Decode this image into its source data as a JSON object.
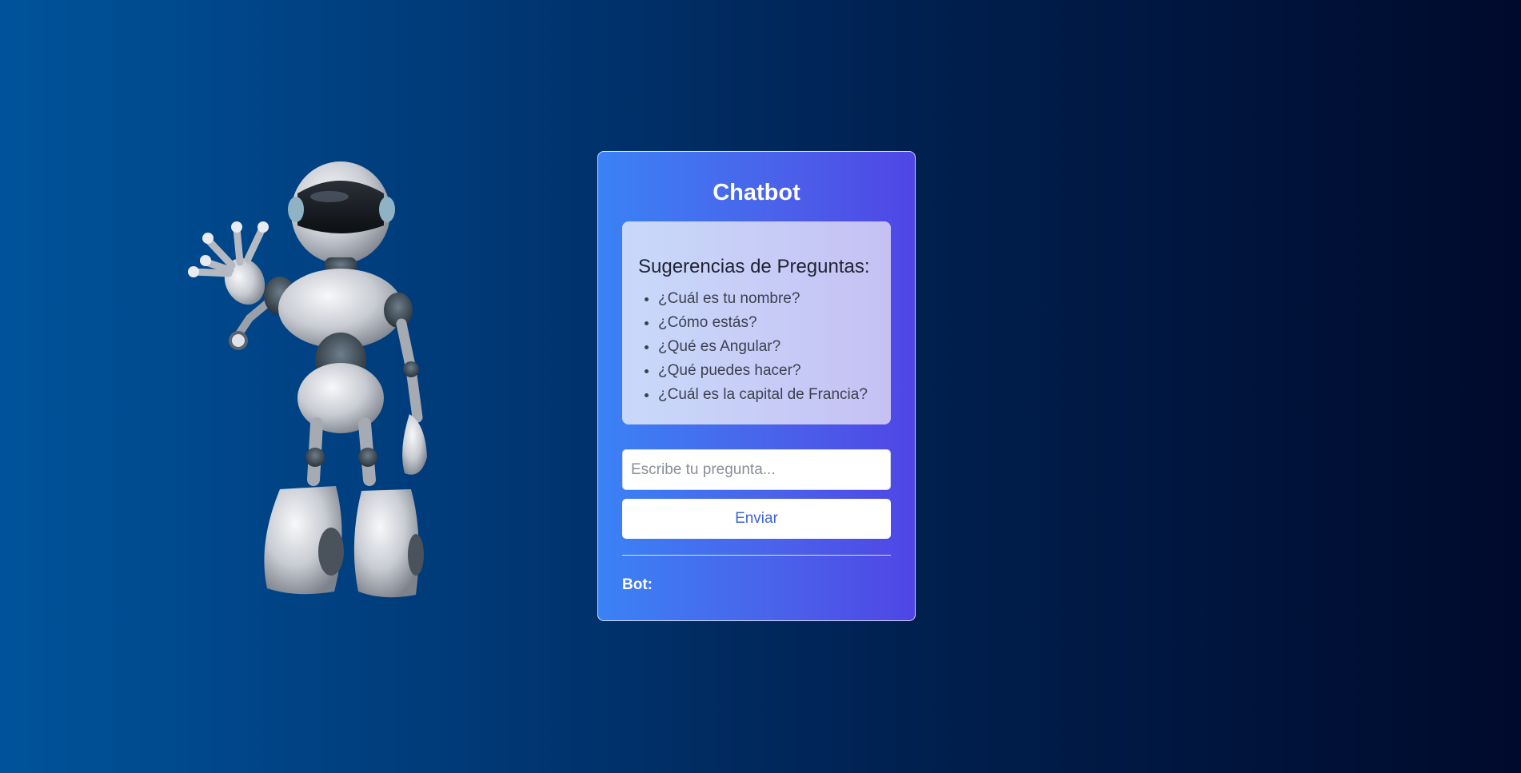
{
  "chatbot": {
    "title": "Chatbot",
    "suggestions": {
      "title": "Sugerencias de Preguntas:",
      "items": [
        "¿Cuál es tu nombre?",
        "¿Cómo estás?",
        "¿Qué es Angular?",
        "¿Qué puedes hacer?",
        "¿Cuál es la capital de Francia?"
      ]
    },
    "input": {
      "placeholder": "Escribe tu pregunta...",
      "value": ""
    },
    "send_label": "Enviar",
    "bot_label": "Bot:",
    "bot_response": ""
  },
  "robot_image": {
    "icon": "waving-robot-illustration"
  },
  "colors": {
    "background_left": "#00539b",
    "background_right": "#000a2c",
    "card_gradient_start": "#3b82f6",
    "card_gradient_end": "#4f46e5",
    "button_text": "#3f63dc"
  }
}
